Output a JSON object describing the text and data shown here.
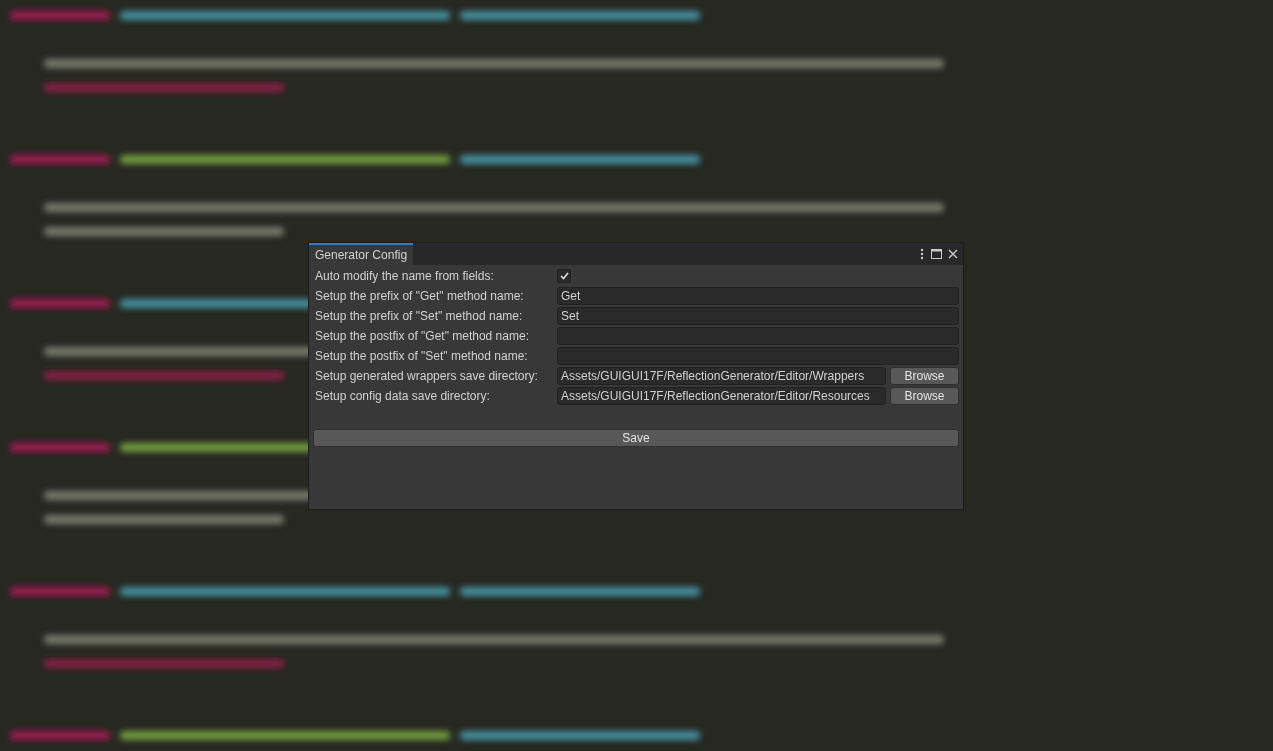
{
  "window": {
    "tab": {
      "label": "Generator Config",
      "selected": true
    }
  },
  "fields": [
    {
      "kind": "checkbox",
      "label": "Auto modify the name from fields:",
      "checked": true
    },
    {
      "kind": "text",
      "label": "Setup the prefix of \"Get\" method name:",
      "value": "Get"
    },
    {
      "kind": "text",
      "label": "Setup the prefix of \"Set\" method name:",
      "value": "Set"
    },
    {
      "kind": "text",
      "label": "Setup the postfix of \"Get\" method name:"
    },
    {
      "kind": "text",
      "label": "Setup the postfix of \"Set\" method name:"
    },
    {
      "kind": "path",
      "label": "Setup generated wrappers save directory:",
      "value": "Assets/GUIGUI17F/ReflectionGenerator/Editor/Wrappers",
      "button": "Browse"
    },
    {
      "kind": "path",
      "label": "Setup config data save directory:",
      "value": "Assets/GUIGUI17F/ReflectionGenerator/Editor/Resources",
      "button": "Browse"
    }
  ],
  "save_button": "Save"
}
